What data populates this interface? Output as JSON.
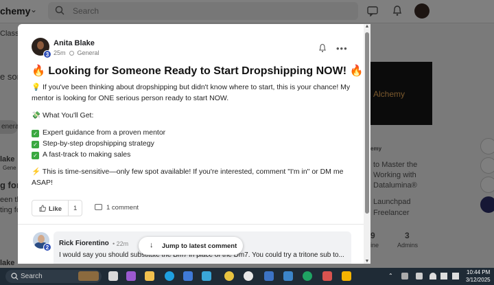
{
  "background": {
    "brand": "chemy",
    "search_placeholder": "Search",
    "left_fragments": [
      "Class",
      "e son",
      "eneral",
      "lake",
      "Gene",
      "g for",
      "een th",
      "ting fo",
      "lake"
    ],
    "right_panel_logo": "Alchemy",
    "right_texts": [
      "emy",
      "to Master the",
      "Working with",
      "Datalumina®",
      "Launchpad",
      "Freelancer",
      "9",
      "3",
      "ine",
      "Admins"
    ]
  },
  "post": {
    "author": "Anita Blake",
    "author_level": "3",
    "time": "25m",
    "category": "General",
    "title": "🔥 Looking for Someone Ready to Start Dropshipping NOW! 🔥",
    "intro": "💡 If you've been thinking about dropshipping but didn't know where to start, this is your chance! My mentor is looking for ONE serious person ready to start NOW.",
    "what_heading": "💸 What You'll Get:",
    "benefits": [
      "Expert guidance from a proven mentor",
      "Step-by-step dropshipping strategy",
      "A fast-track to making sales"
    ],
    "urgency": "⚡ This is time-sensitive—only few spot available! If you're interested, comment \"I'm in\" or DM me ASAP!",
    "like_label": "Like",
    "like_count": "1",
    "comment_count_label": "1 comment"
  },
  "comment": {
    "author": "Rick Fiorentino",
    "author_level": "2",
    "time": "• 22m",
    "text": "I would say you should substitute the Bm7 in place of the Dm7. You could try a tritone sub to..."
  },
  "jump_button": {
    "label": "Jump to latest comment"
  },
  "taskbar": {
    "search_label": "Search",
    "time": "10:44 PM",
    "date": "3/12/2025",
    "icons": [
      "file-explorer",
      "edge",
      "store",
      "chrome",
      "mail",
      "notes",
      "grammarly",
      "drive"
    ],
    "colors": {
      "accent": "#2f4fb8",
      "taskbar": "#1f2b36"
    }
  }
}
